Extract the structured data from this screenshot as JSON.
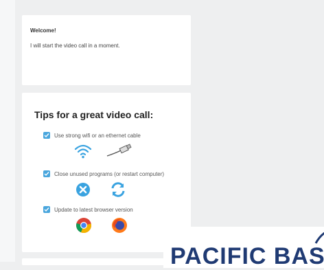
{
  "welcome": {
    "title": "Welcome!",
    "message": "I will start the video call in a moment."
  },
  "tips": {
    "title": "Tips for a great video call:",
    "items": [
      {
        "text": "Use strong wifi or an ethernet cable",
        "icons": [
          "wifi-icon",
          "ethernet-cable-icon"
        ]
      },
      {
        "text": "Close unused programs (or restart computer)",
        "icons": [
          "close-icon",
          "refresh-icon"
        ]
      },
      {
        "text": "Update to latest browser version",
        "icons": [
          "chrome-icon",
          "firefox-icon"
        ]
      }
    ]
  },
  "logo": {
    "text": "PACIFIC BAS"
  },
  "colors": {
    "check_blue": "#4aa6dd",
    "icon_blue": "#3aa3e0",
    "logo_navy": "#1f3a73",
    "background": "#eeeff0"
  }
}
